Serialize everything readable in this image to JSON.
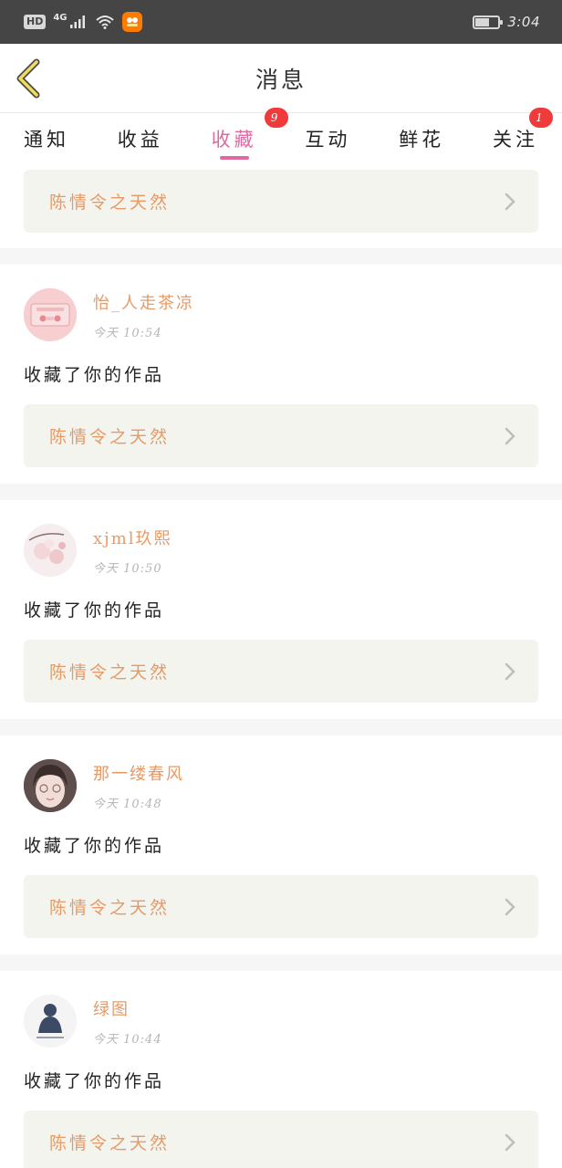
{
  "status_bar": {
    "hd": "HD",
    "network": "4G",
    "time": "3:04",
    "icons": [
      "signal-icon",
      "wifi-icon",
      "app-notification-icon",
      "battery-icon"
    ]
  },
  "header": {
    "title": "消息",
    "back_icon": "chevron-left-icon"
  },
  "tabs": [
    {
      "label": "通知",
      "badge": ""
    },
    {
      "label": "收益",
      "badge": ""
    },
    {
      "label": "收藏",
      "badge": "9",
      "active": true
    },
    {
      "label": "互动",
      "badge": ""
    },
    {
      "label": "鲜花",
      "badge": ""
    },
    {
      "label": "关注",
      "badge": "1"
    }
  ],
  "top_card": {
    "title": "陈情令之天然"
  },
  "messages": [
    {
      "user": "怡_人走茶凉",
      "time": "今天 10:54",
      "action": "收藏了你的作品",
      "work": "陈情令之天然"
    },
    {
      "user": "xjml玖熙",
      "time": "今天 10:50",
      "action": "收藏了你的作品",
      "work": "陈情令之天然"
    },
    {
      "user": "那一缕春风",
      "time": "今天 10:48",
      "action": "收藏了你的作品",
      "work": "陈情令之天然"
    },
    {
      "user": "绿图",
      "time": "今天 10:44",
      "action": "收藏了你的作品",
      "work": "陈情令之天然"
    }
  ],
  "colors": {
    "accent_pink": "#e06aa0",
    "username_orange": "#e79a66",
    "badge_red": "#ef3b3b",
    "card_bg": "#f4f4ee",
    "status_bar_bg": "#454545"
  }
}
